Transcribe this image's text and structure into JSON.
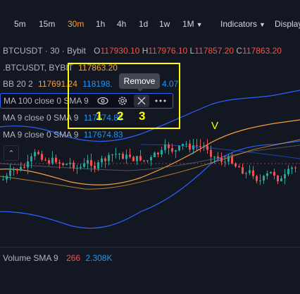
{
  "toolbar": {
    "timeframes": [
      "5m",
      "15m",
      "30m",
      "1h",
      "4h",
      "1d",
      "1w",
      "1M"
    ],
    "active_timeframe": "30m",
    "indicators_label": "Indicators",
    "display_label": "Display"
  },
  "legend": {
    "symbol": {
      "name": "BTCUSDT · 30 · Bybit",
      "o_label": "O",
      "o": "117930.10",
      "h_label": "H",
      "h": "117976.10",
      "l_label": "L",
      "l": "117857.20",
      "c_label": "C",
      "c": "117863.20"
    },
    "mark": {
      "name": ".BTCUSDT, BYBIT",
      "value": "117863.20"
    },
    "bb": {
      "name": "BB 20 2",
      "v1": "117691.24",
      "v2": "118198.",
      "v3": "4.07"
    },
    "ma100": {
      "name": "MA 100 close 0 SMA 9"
    },
    "ma9a": {
      "name": "MA 9 close 0 SMA 9",
      "value": "117674.83"
    },
    "ma9b": {
      "name": "MA 9 close 0 SMA 9",
      "value": "117674.83"
    }
  },
  "tooltip": {
    "text": "Remove"
  },
  "annotations": {
    "n1": "1",
    "n2": "2",
    "n3": "3",
    "v": "V"
  },
  "volume": {
    "name": "Volume SMA 9",
    "v1": "266",
    "v2": "2.308K"
  },
  "colors": {
    "accent": "#f7a13c",
    "up": "#26a69a",
    "down": "#ef5350",
    "annotation": "#ffff00",
    "selection": "#2962ff"
  },
  "icons": [
    "eye-icon",
    "gear-icon",
    "close-icon",
    "more-icon",
    "chevron-down-icon"
  ]
}
